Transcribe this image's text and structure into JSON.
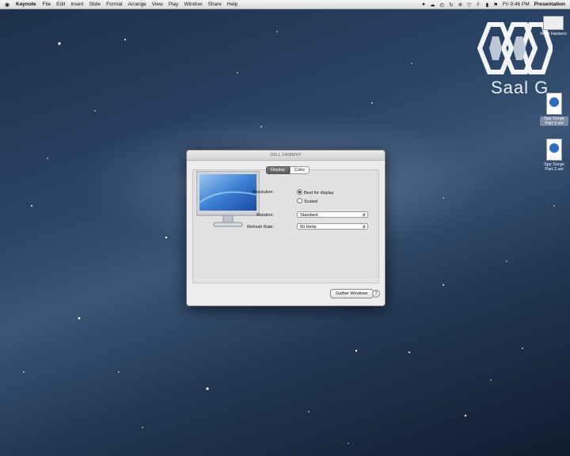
{
  "menubar": {
    "apple_icon": "apple-icon",
    "app_name": "Keynote",
    "menus": [
      "File",
      "Edit",
      "Insert",
      "Slide",
      "Format",
      "Arrange",
      "View",
      "Play",
      "Window",
      "Share",
      "Help"
    ],
    "clock": "Fri 9:46 PM",
    "mode": "Presentation"
  },
  "desktop": {
    "logo_text": "Saal G",
    "icons": [
      {
        "label": "WWI Hackers"
      },
      {
        "label": "Spy Sorge Part 2.avi"
      },
      {
        "label": "Spy Sorge Part 2.avi"
      }
    ]
  },
  "window": {
    "title": "DELL 2408WFP",
    "tabs": [
      "Display",
      "Color"
    ],
    "resolution_label": "Resolution:",
    "resolution_options": [
      "Best for display",
      "Scaled"
    ],
    "rotation_label": "Rotation:",
    "rotation_value": "Standard",
    "refresh_label": "Refresh Rate:",
    "refresh_value": "60 Hertz",
    "gather_button": "Gather Windows",
    "help_button": "?"
  }
}
